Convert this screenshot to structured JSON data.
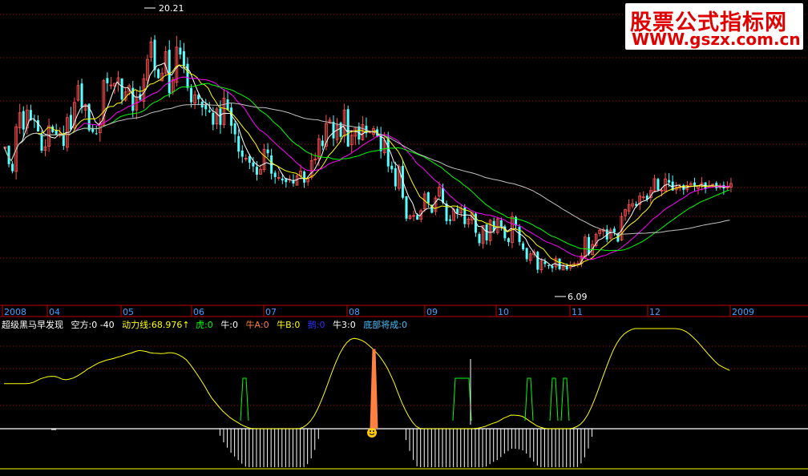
{
  "watermark": {
    "line1": "股票公式指标网",
    "line2": "WWW.gszx.com.cn"
  },
  "legend": {
    "title": "超级黑马早发现",
    "items": [
      {
        "text": "空方:0  -40",
        "color": "#ffffff"
      },
      {
        "text": "动力线:68.976↑",
        "color": "#ffff00"
      },
      {
        "text": "虎:0",
        "color": "#00ff00"
      },
      {
        "text": "牛:0",
        "color": "#ffffff"
      },
      {
        "text": "牛A:0",
        "color": "#ff8040"
      },
      {
        "text": "牛B:0",
        "color": "#ffff00"
      },
      {
        "text": "鹅:0",
        "color": "#0000ff"
      },
      {
        "text": "牛3:0",
        "color": "#ffffff"
      },
      {
        "text": "底部将成:0",
        "color": "#40c0ff"
      }
    ]
  },
  "chart_data": {
    "type": "candlestick",
    "price_range": [
      4.5,
      21.6
    ],
    "max_label": "20.21",
    "min_label": "6.09",
    "x_axis_labels": [
      "2008",
      "04",
      "05",
      "06",
      "07",
      "08",
      "09",
      "10",
      "11",
      "12",
      "2009"
    ],
    "indicator_range": [
      -40,
      100
    ],
    "colors": {
      "up": "#ff5050",
      "down": "#54ffff",
      "ma5": "#ffffff",
      "ma10": "#ffff00",
      "ma20": "#ff00ff",
      "ma30": "#00ff00",
      "ma60": "#c0c0c0",
      "power": "#ffff00",
      "kong": "#ffffff",
      "tiger": "#00ff00",
      "nuA": "#ff8040",
      "grid": "#c00000"
    },
    "closes": [
      13.64,
      12.64,
      12.23,
      14.81,
      15.62,
      14.65,
      15.78,
      15.2,
      15.18,
      14.54,
      13.42,
      13.64,
      14.86,
      14.5,
      14.34,
      14.44,
      13.7,
      15.34,
      14.65,
      16.22,
      17.2,
      15.93,
      16.09,
      14.6,
      14.51,
      14.38,
      15.01,
      17.48,
      17.33,
      17.23,
      17.33,
      17.65,
      16.38,
      16.83,
      17.19,
      15.73,
      16.54,
      16.37,
      17.6,
      18.71,
      19.72,
      18.09,
      17.63,
      17.92,
      19.16,
      16.75,
      17.55,
      19.42,
      19.0,
      18.31,
      17.06,
      16.23,
      16.66,
      16.4,
      15.93,
      15.82,
      15.67,
      14.93,
      15.84,
      14.92,
      16.47,
      15.78,
      14.87,
      14.37,
      13.37,
      13.07,
      12.98,
      12.73,
      12.51,
      12.03,
      12.34,
      13.5,
      13.27,
      12.09,
      11.89,
      11.87,
      11.7,
      11.6,
      11.76,
      11.52,
      11.95,
      12.24,
      11.57,
      11.8,
      12.85,
      12.94,
      14.11,
      13.69,
      14.99,
      15.19,
      14.13,
      14.91,
      14.22,
      15.78,
      13.66,
      14.31,
      14.73,
      14.07,
      14.94,
      14.43,
      14.5,
      14.7,
      14.28,
      13.39,
      14.01,
      12.51,
      12.34,
      11.35,
      12.5,
      10.69,
      9.48,
      9.64,
      9.66,
      9.42,
      9.94,
      10.91,
      10.37,
      9.82,
      10.68,
      11.31,
      10.42,
      9.34,
      9.35,
      10.01,
      9.8,
      10.08,
      9.16,
      9.45,
      9.83,
      8.66,
      8.06,
      9.08,
      8.22,
      9.38,
      8.77,
      9.47,
      9.02,
      8.34,
      8.12,
      9.6,
      9.08,
      8.12,
      7.7,
      7.13,
      7.44,
      7.55,
      6.52,
      7.02,
      6.85,
      6.76,
      6.61,
      7.16,
      6.55,
      6.77,
      6.54,
      6.79,
      6.88,
      6.87,
      7.32,
      8.41,
      7.42,
      7.98,
      8.56,
      8.8,
      8.85,
      8.27,
      8.82,
      8.68,
      8.15,
      9.6,
      10.0,
      10.28,
      10.35,
      10.23,
      10.79,
      10.74,
      10.59,
      11.11,
      11.79,
      11.14,
      11.13,
      11.78,
      11.57,
      11.11,
      11.32,
      11.35,
      11.15,
      11.4,
      11.52,
      11.35,
      11.39,
      11.55,
      11.2,
      11.37,
      11.48,
      11.24,
      11.36,
      11.23,
      11.33,
      11.52
    ],
    "indicator": {
      "name": "动力线",
      "last_value": 68.976,
      "kong_fang": 0
    }
  }
}
